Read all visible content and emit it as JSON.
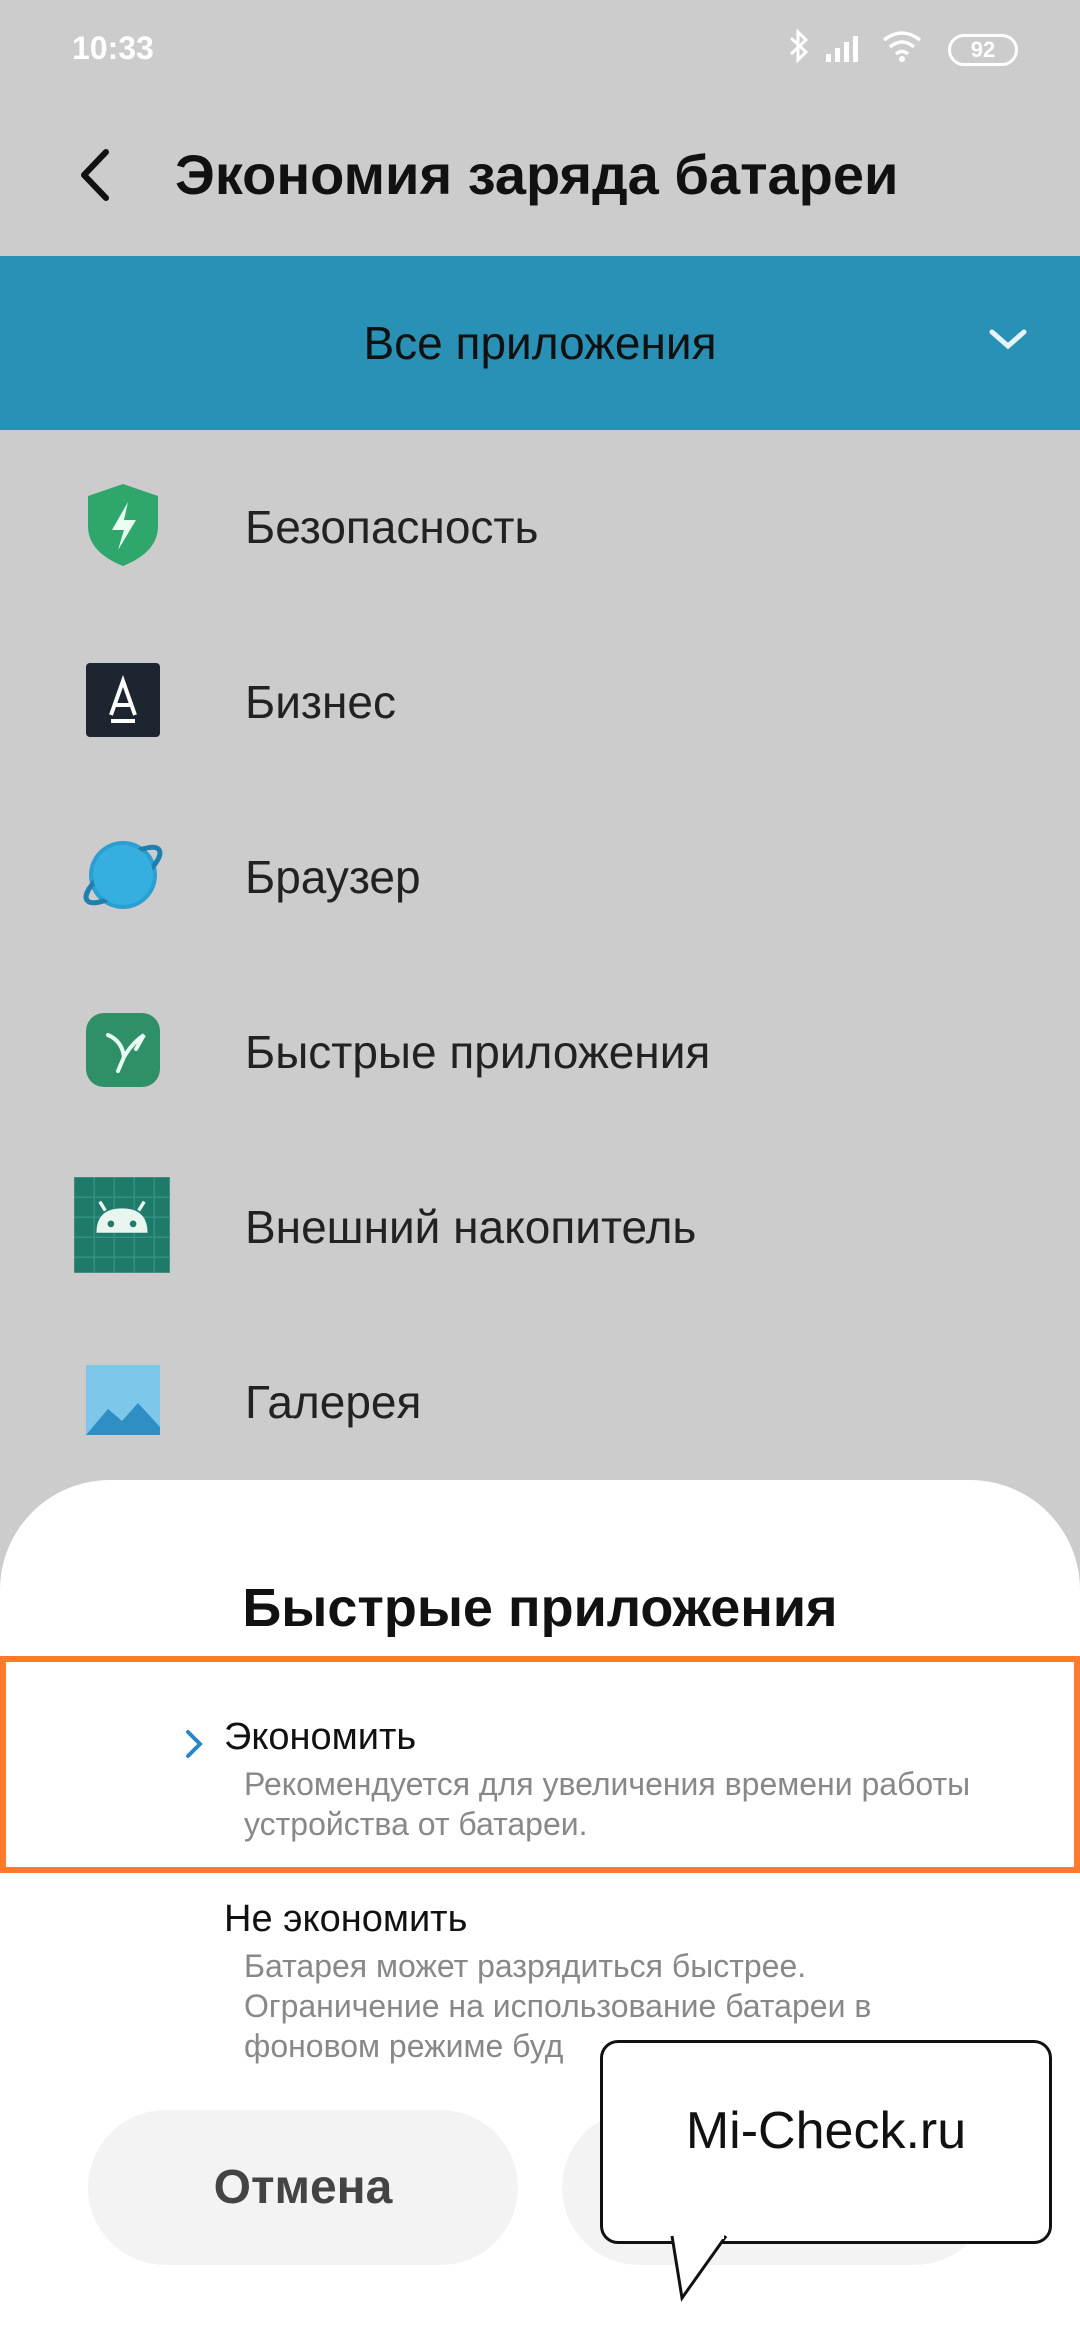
{
  "status_bar": {
    "time": "10:33",
    "battery": "92"
  },
  "header": {
    "title": "Экономия заряда батареи"
  },
  "filter": {
    "label": "Все приложения"
  },
  "apps": [
    {
      "label": "Безопасность",
      "icon": "security-shield-icon"
    },
    {
      "label": "Бизнес",
      "icon": "business-a-icon"
    },
    {
      "label": "Браузер",
      "icon": "browser-planet-icon"
    },
    {
      "label": "Быстрые приложения",
      "icon": "quick-apps-bird-icon"
    },
    {
      "label": "Внешний накопитель",
      "icon": "android-storage-icon"
    },
    {
      "label": "Галерея",
      "icon": "gallery-image-icon"
    }
  ],
  "sheet": {
    "title": "Быстрые приложения",
    "options": [
      {
        "title": "Экономить",
        "description": "Рекомендуется для увеличения времени работы устройства от батареи.",
        "selected": true
      },
      {
        "title": "Не экономить",
        "description": "Батарея может разрядиться быстрее. Ограничение на использование батареи в фоновом режиме буд",
        "selected": false
      }
    ],
    "cancel_label": "Отмена"
  },
  "watermark": {
    "text": "Mi-Check.ru"
  },
  "colors": {
    "accent_bar": "#2891b5",
    "highlight": "#ff7a2b",
    "chevron": "#2a87c8"
  }
}
